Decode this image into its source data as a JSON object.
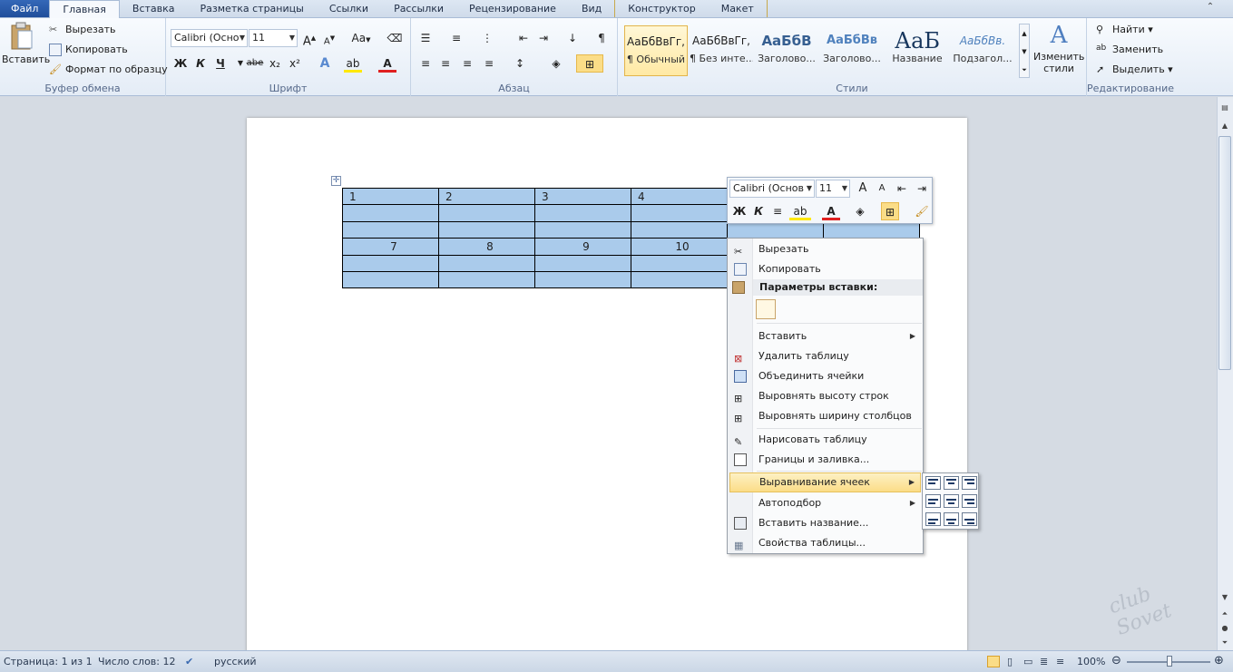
{
  "tabs": [
    {
      "label": "Файл"
    },
    {
      "label": "Главная"
    },
    {
      "label": "Вставка"
    },
    {
      "label": "Разметка страницы"
    },
    {
      "label": "Ссылки"
    },
    {
      "label": "Рассылки"
    },
    {
      "label": "Рецензирование"
    },
    {
      "label": "Вид"
    },
    {
      "label": "Конструктор"
    },
    {
      "label": "Макет"
    }
  ],
  "ribbon": {
    "clipboard": {
      "paste": "Вставить",
      "cut": "Вырезать",
      "copy": "Копировать",
      "format_painter": "Формат по образцу",
      "label": "Буфер обмена"
    },
    "font": {
      "name": "Calibri (Осно",
      "size": "11",
      "bold": "Ж",
      "italic": "К",
      "underline": "Ч",
      "strike": "abe",
      "sub": "x₂",
      "sup": "x²",
      "label": "Шрифт",
      "grow": "A",
      "shrink": "A",
      "case": "Aa"
    },
    "paragraph": {
      "label": "Абзац",
      "pilcrow": "¶"
    },
    "styles": {
      "label": "Стили",
      "change": "Изменить",
      "change2": "стили",
      "items": [
        {
          "sample": "АаБбВвГг,",
          "name": "¶ Обычный"
        },
        {
          "sample": "АаБбВвГг,",
          "name": "¶ Без инте..."
        },
        {
          "sample": "АаБбВ",
          "name": "Заголово..."
        },
        {
          "sample": "АаБбВв",
          "name": "Заголово..."
        },
        {
          "sample": "АаБ",
          "name": "Название"
        },
        {
          "sample": "АаБбВв.",
          "name": "Подзагол..."
        }
      ]
    },
    "editing": {
      "find": "Найти",
      "replace": "Заменить",
      "select": "Выделить",
      "label": "Редактирование"
    }
  },
  "table": {
    "rows": [
      [
        "1",
        "2",
        "3",
        "4",
        "",
        ""
      ],
      [
        "",
        "",
        "",
        "",
        "",
        ""
      ],
      [
        "",
        "",
        "",
        "",
        "",
        ""
      ],
      [
        "7",
        "8",
        "9",
        "10",
        "",
        ""
      ],
      [
        "",
        "",
        "",
        "",
        "",
        ""
      ],
      [
        "",
        "",
        "",
        "",
        "",
        ""
      ]
    ]
  },
  "mini_toolbar": {
    "font": "Calibri (Основ",
    "size": "11",
    "bold": "Ж",
    "italic": "К"
  },
  "context_menu": {
    "cut": "Вырезать",
    "copy": "Копировать",
    "paste_options": "Параметры вставки:",
    "insert": "Вставить",
    "delete_table": "Удалить таблицу",
    "merge": "Объединить ячейки",
    "distribute_rows": "Выровнять высоту строк",
    "distribute_cols": "Выровнять ширину столбцов",
    "draw_table": "Нарисовать таблицу",
    "borders": "Границы и заливка...",
    "cell_align": "Выравнивание ячеек",
    "autofit": "Автоподбор",
    "caption": "Вставить название...",
    "properties": "Свойства таблицы..."
  },
  "status": {
    "page": "Страница: 1 из 1",
    "words": "Число слов: 12",
    "lang": "русский",
    "zoom": "100%"
  },
  "watermark": "club Sovet",
  "colors": {
    "accent": "#2b5797",
    "selection": "#aacbeb",
    "highlight": "#fbdd87"
  }
}
